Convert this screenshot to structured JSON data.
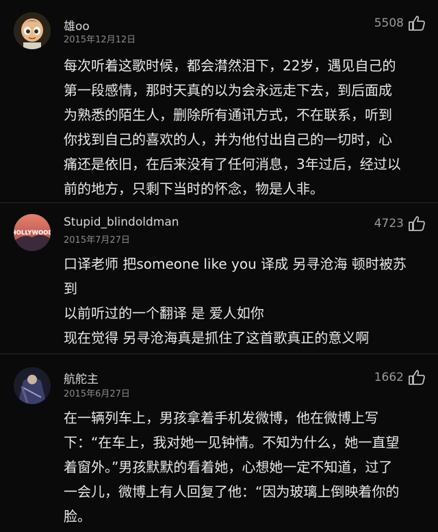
{
  "comments": [
    {
      "username": "雄oo",
      "date": "2015年12月12日",
      "likes": "5508",
      "avatar_icon": "cartoon-boy-avatar",
      "lines": [
        "每次听着这歌时候，都会潸然泪下，22岁，遇见自己的",
        "第一段感情，那时天真的以为会永远走下去，到后面成",
        "为熟悉的陌生人，删除所有通讯方式，不在联系，听到",
        "你找到自己的喜欢的人，并为他付出自己的一切时，心",
        "痛还是依旧，在后来没有了任何消息，3年过后，经过以",
        "前的地方，只剩下当时的怀念，物是人非。"
      ]
    },
    {
      "username": "Stupid_blindoldman",
      "date": "2015年7月27日",
      "likes": "4723",
      "avatar_icon": "hollywood-sign-avatar",
      "avatar_text": "HOLLYWOOD",
      "lines": [
        "口译老师  把someone  like  you 译成 另寻沧海 顿时被苏",
        "到",
        "以前听过的一个翻译  是 爱人如你",
        "现在觉得 另寻沧海真是抓住了这首歌真正的意义啊"
      ]
    },
    {
      "username": "航舵主",
      "date": "2015年6月27日",
      "likes": "1662",
      "avatar_icon": "warrior-avatar",
      "lines": [
        "在一辆列车上，男孩拿着手机发微博，他在微博上写",
        "下：“在车上，我对她一见钟情。不知为什么，她一直望",
        "着窗外。”男孩默默的看着她，心想她一定不知道，过了",
        "一会儿，微博上有人回复了他：“因为玻璃上倒映着你的",
        "脸。"
      ]
    }
  ]
}
